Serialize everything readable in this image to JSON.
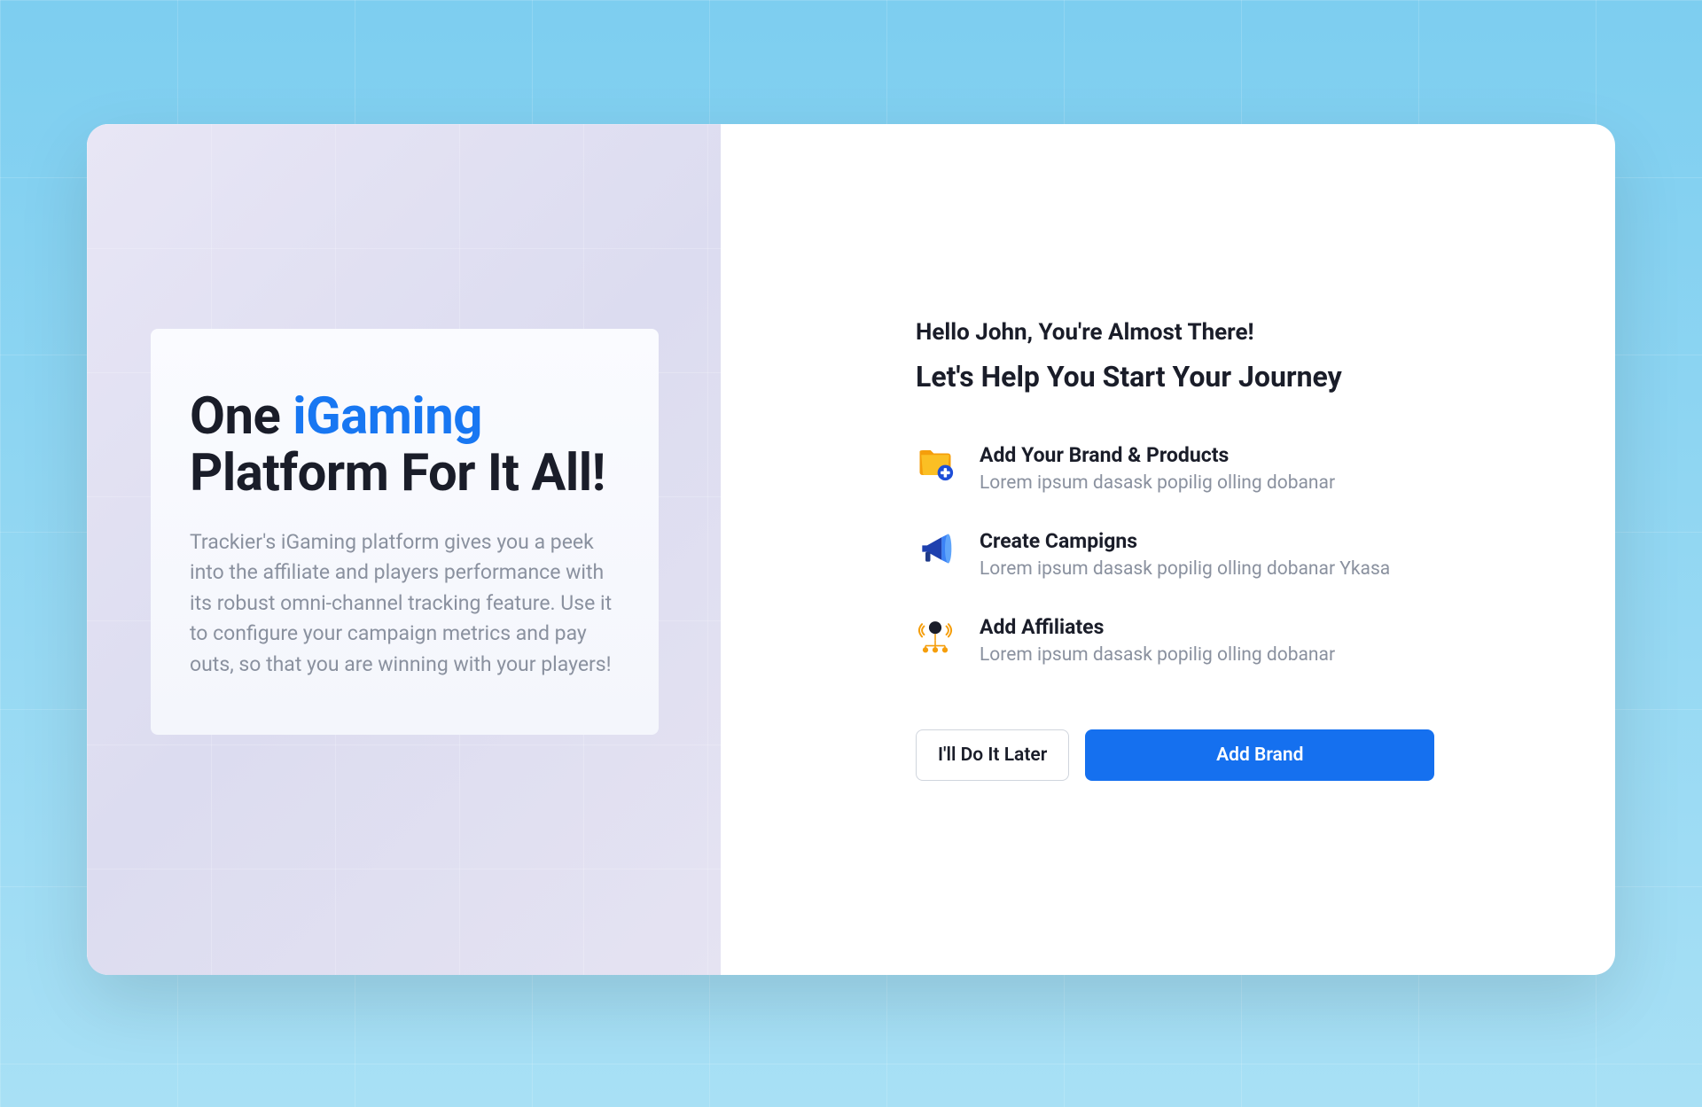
{
  "left_panel": {
    "title_part1": "One ",
    "title_highlight": "iGaming",
    "title_part2": " Platform For It All!",
    "description": "Trackier's iGaming platform gives you a peek into the affiliate and players performance with its robust omni-channel tracking feature. Use it to configure your campaign metrics and pay outs, so that you are winning with your players!"
  },
  "right_panel": {
    "greeting": "Hello John, You're Almost There!",
    "subtitle": "Let's Help You Start Your Journey",
    "steps": [
      {
        "title": "Add Your Brand & Products",
        "description": "Lorem ipsum dasask popilig olling dobanar"
      },
      {
        "title": "Create Campigns",
        "description": "Lorem ipsum dasask popilig olling dobanar Ykasa"
      },
      {
        "title": "Add Affiliates",
        "description": "Lorem ipsum dasask popilig olling dobanar"
      }
    ],
    "buttons": {
      "secondary": "I'll Do It Later",
      "primary": "Add Brand"
    }
  }
}
